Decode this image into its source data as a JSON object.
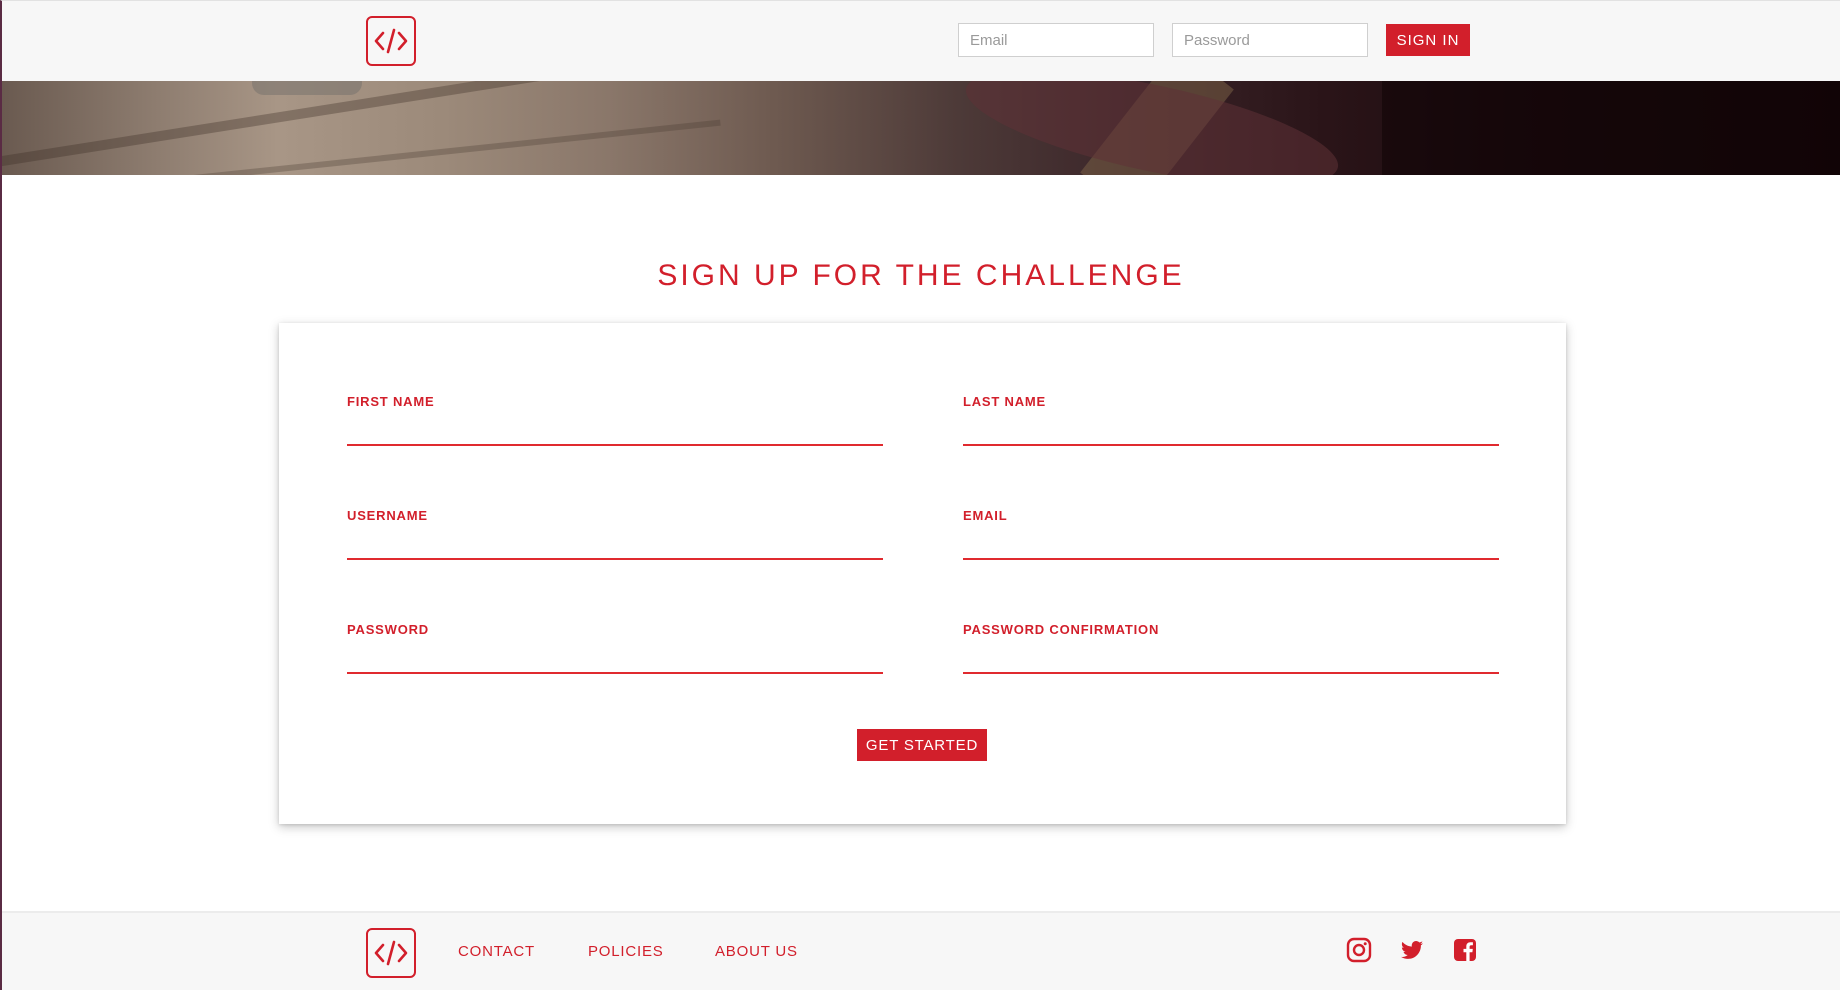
{
  "colors": {
    "accent": "#d21f2b",
    "underline": "#e02a2f",
    "header_bg": "#f7f7f7",
    "card_bg": "#ffffff"
  },
  "header": {
    "logo_icon": "code-brackets-icon",
    "email_placeholder": "Email",
    "password_placeholder": "Password",
    "sign_in_label": "SIGN IN"
  },
  "main": {
    "title": "SIGN UP FOR THE CHALLENGE",
    "fields": {
      "first_name": "FIRST NAME",
      "last_name": "LAST NAME",
      "username": "USERNAME",
      "email": "EMAIL",
      "password": "PASSWORD",
      "password_confirmation": "PASSWORD CONFIRMATION"
    },
    "values": {
      "first_name": "",
      "last_name": "",
      "username": "",
      "email": "",
      "password": "",
      "password_confirmation": ""
    },
    "submit_label": "GET STARTED"
  },
  "footer": {
    "logo_icon": "code-brackets-icon",
    "links": [
      "CONTACT",
      "POLICIES",
      "ABOUT US"
    ],
    "social_icons": [
      "instagram-icon",
      "twitter-icon",
      "facebook-icon"
    ]
  }
}
